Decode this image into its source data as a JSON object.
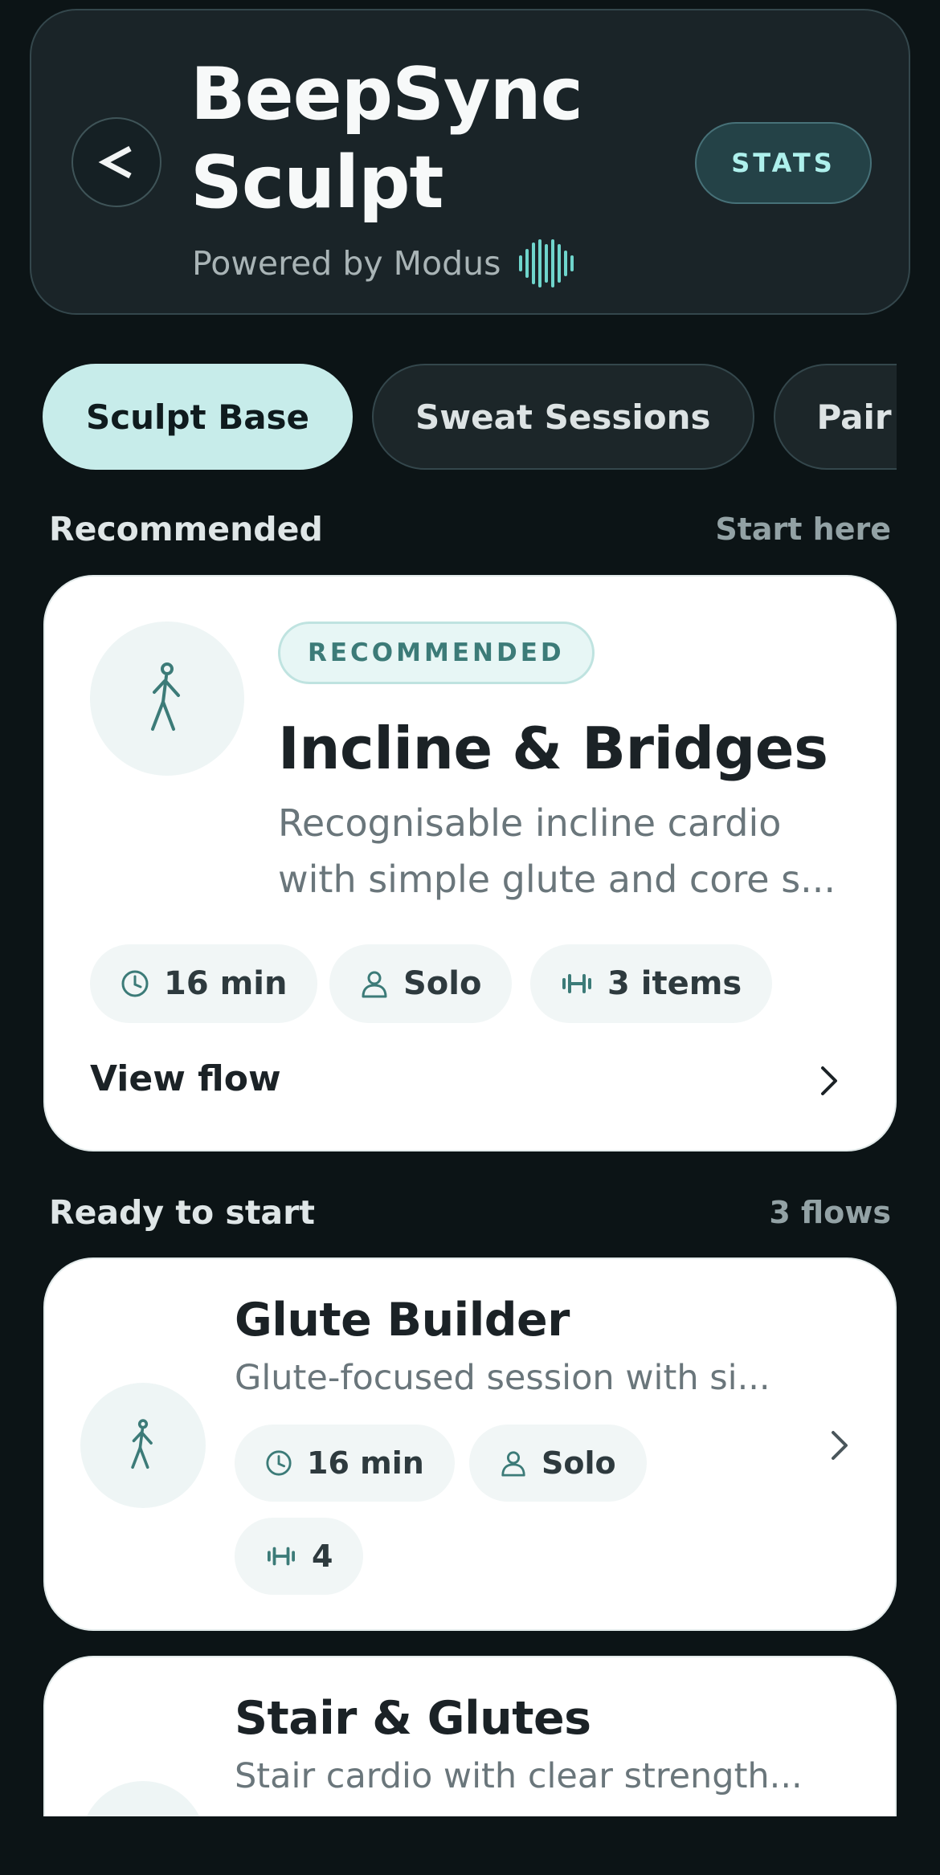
{
  "header": {
    "back_label": "<",
    "title_line1": "BeepSync",
    "title_line2": "Sculpt",
    "subtitle": "Powered by Modus",
    "stats_label": "STATS"
  },
  "tabs": [
    {
      "label": "Sculpt Base",
      "active": true
    },
    {
      "label": "Sweat Sessions",
      "active": false
    },
    {
      "label": "Pair +",
      "active": false
    }
  ],
  "recommended_section": {
    "title": "Recommended",
    "meta": "Start here"
  },
  "recommended_card": {
    "badge": "RECOMMENDED",
    "title": "Incline & Bridges",
    "description_line1": "Recognisable incline cardio",
    "description_line2": "with simple glute and core s...",
    "duration": "16 min",
    "mode": "Solo",
    "items": "3 items",
    "action_label": "View flow"
  },
  "ready_section": {
    "title": "Ready to start",
    "meta": "3 flows"
  },
  "flows": [
    {
      "title": "Glute Builder",
      "description": "Glute-focused session with si...",
      "duration": "16 min",
      "mode": "Solo",
      "equipment": "4"
    },
    {
      "title": "Stair & Glutes",
      "description": "Stair cardio with clear strength..."
    }
  ],
  "colors": {
    "background": "#0c1416",
    "accent": "#c7ecea",
    "accent_text": "#3c7b78",
    "card": "#ffffff"
  }
}
